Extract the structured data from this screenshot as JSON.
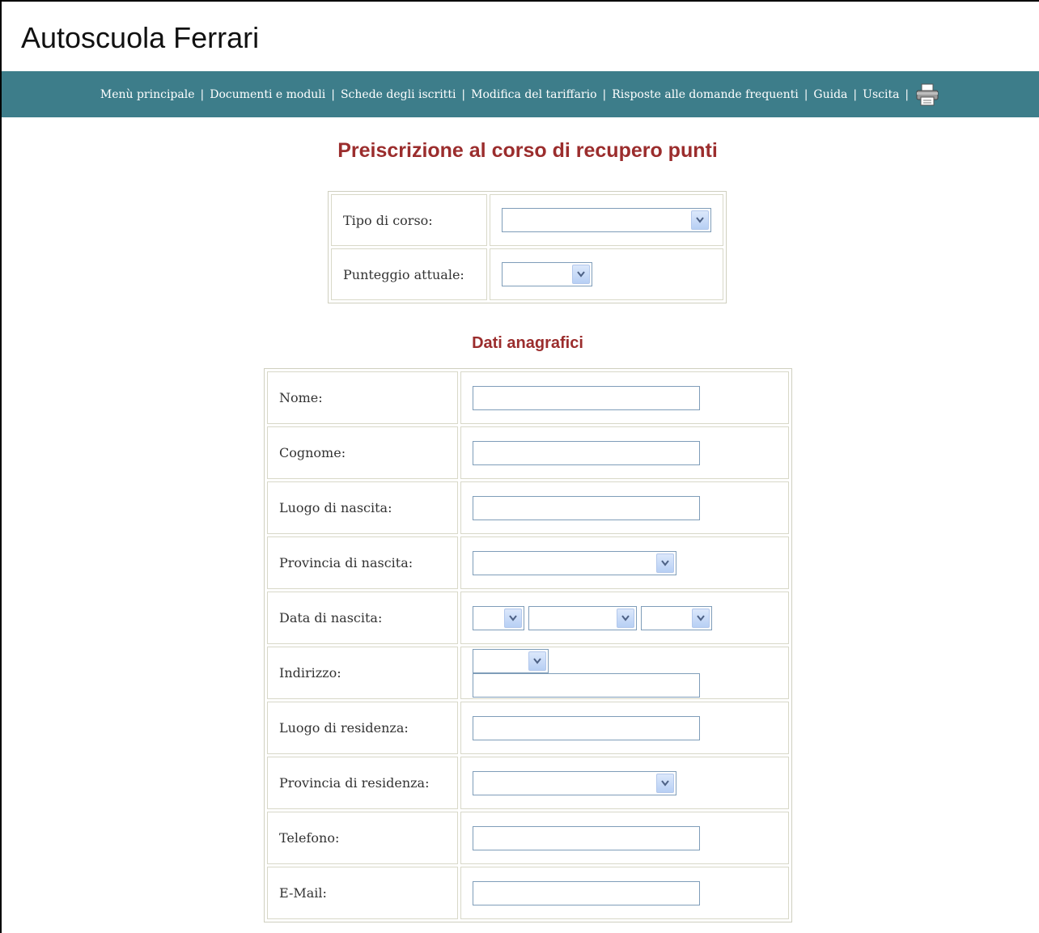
{
  "app": {
    "title": "Autoscuola Ferrari"
  },
  "nav": {
    "items": [
      "Menù principale",
      "Documenti e moduli",
      "Schede degli iscritti",
      "Modifica del tariffario",
      "Risposte alle domande frequenti",
      "Guida",
      "Uscita"
    ],
    "separator": "|",
    "print_icon": "printer-icon"
  },
  "page": {
    "heading": "Preiscrizione al corso di recupero punti",
    "course": {
      "tipo_label": "Tipo di corso:",
      "tipo_value": "",
      "punteggio_label": "Punteggio attuale:",
      "punteggio_value": ""
    },
    "anagrafica": {
      "heading": "Dati anagrafici",
      "nome_label": "Nome:",
      "nome_value": "",
      "cognome_label": "Cognome:",
      "cognome_value": "",
      "luogo_nascita_label": "Luogo di nascita:",
      "luogo_nascita_value": "",
      "provincia_nascita_label": "Provincia di nascita:",
      "provincia_nascita_value": "",
      "data_nascita_label": "Data di nascita:",
      "data_nascita_day": "",
      "data_nascita_month": "",
      "data_nascita_year": "",
      "indirizzo_label": "Indirizzo:",
      "indirizzo_type": "",
      "indirizzo_value": "",
      "luogo_residenza_label": "Luogo di residenza:",
      "luogo_residenza_value": "",
      "provincia_residenza_label": "Provincia di residenza:",
      "provincia_residenza_value": "",
      "telefono_label": "Telefono:",
      "telefono_value": "",
      "email_label": "E-Mail:",
      "email_value": ""
    }
  },
  "colors": {
    "nav_bg": "#3d7d8a",
    "heading": "#9b2d2d",
    "input_border": "#7f9db9"
  }
}
